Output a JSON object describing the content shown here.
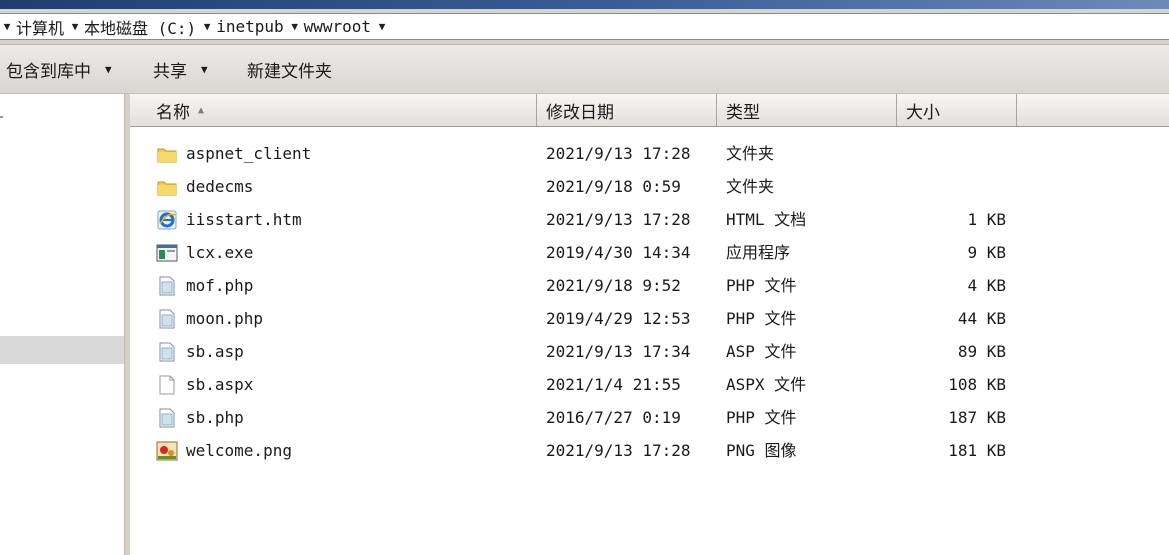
{
  "breadcrumb": {
    "items": [
      "计算机",
      "本地磁盘 (C:)",
      "inetpub",
      "wwwroot"
    ]
  },
  "toolbar": {
    "include_label": "包含到库中",
    "share_label": "共享",
    "new_folder_label": "新建文件夹"
  },
  "columns": {
    "name": "名称",
    "date": "修改日期",
    "type": "类型",
    "size": "大小"
  },
  "files": [
    {
      "name": "aspnet_client",
      "date": "2021/9/13 17:28",
      "type": "文件夹",
      "size": "",
      "icon": "folder-icon"
    },
    {
      "name": "dedecms",
      "date": "2021/9/18 0:59",
      "type": "文件夹",
      "size": "",
      "icon": "folder-icon"
    },
    {
      "name": "iisstart.htm",
      "date": "2021/9/13 17:28",
      "type": "HTML 文档",
      "size": "1 KB",
      "icon": "ie-html-icon"
    },
    {
      "name": "lcx.exe",
      "date": "2019/4/30 14:34",
      "type": "应用程序",
      "size": "9 KB",
      "icon": "exe-icon"
    },
    {
      "name": "mof.php",
      "date": "2021/9/18 9:52",
      "type": "PHP 文件",
      "size": "4 KB",
      "icon": "script-file-icon"
    },
    {
      "name": "moon.php",
      "date": "2019/4/29 12:53",
      "type": "PHP 文件",
      "size": "44 KB",
      "icon": "script-file-icon"
    },
    {
      "name": "sb.asp",
      "date": "2021/9/13 17:34",
      "type": "ASP 文件",
      "size": "89 KB",
      "icon": "script-file-icon"
    },
    {
      "name": "sb.aspx",
      "date": "2021/1/4 21:55",
      "type": "ASPX 文件",
      "size": "108 KB",
      "icon": "blank-file-icon"
    },
    {
      "name": "sb.php",
      "date": "2016/7/27 0:19",
      "type": "PHP 文件",
      "size": "187 KB",
      "icon": "script-file-icon"
    },
    {
      "name": "welcome.png",
      "date": "2021/9/13 17:28",
      "type": "PNG 图像",
      "size": "181 KB",
      "icon": "image-file-icon"
    }
  ],
  "colors": {
    "title_strip": "#2b4c80",
    "chrome": "#d6d3ce",
    "nav_selection": "#d8d8d8"
  }
}
